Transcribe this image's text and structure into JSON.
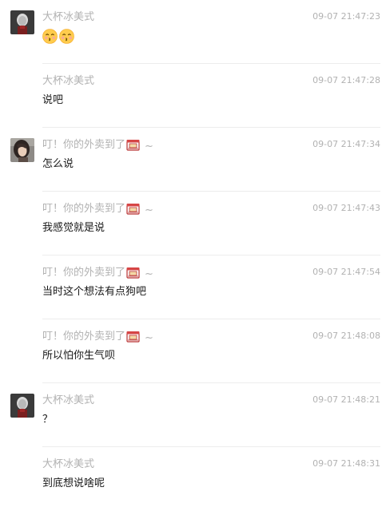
{
  "messages": [
    {
      "sender": "大杯冰美式",
      "time": "09-07 21:47:23",
      "text": "",
      "emojis": [
        "kissing-face-emoji",
        "kissing-face-emoji"
      ],
      "avatar": "avatar-dark",
      "suffix": false
    },
    {
      "sender": "大杯冰美式",
      "time": "09-07 21:47:28",
      "text": "说吧",
      "emojis": [],
      "avatar": "",
      "suffix": false
    },
    {
      "sender": "叮！你的外卖到了",
      "time": "09-07 21:47:34",
      "text": "怎么说",
      "emojis": [],
      "avatar": "avatar-girl",
      "suffix": true
    },
    {
      "sender": "叮！你的外卖到了",
      "time": "09-07 21:47:43",
      "text": "我感觉就是说",
      "emojis": [],
      "avatar": "",
      "suffix": true
    },
    {
      "sender": "叮！你的外卖到了",
      "time": "09-07 21:47:54",
      "text": "当时这个想法有点狗吧",
      "emojis": [],
      "avatar": "",
      "suffix": true
    },
    {
      "sender": "叮！你的外卖到了",
      "time": "09-07 21:48:08",
      "text": "所以怕你生气呗",
      "emojis": [],
      "avatar": "",
      "suffix": true
    },
    {
      "sender": "大杯冰美式",
      "time": "09-07 21:48:21",
      "text": "？",
      "emojis": [],
      "avatar": "avatar-dark",
      "suffix": false
    },
    {
      "sender": "大杯冰美式",
      "time": "09-07 21:48:31",
      "text": "到底想说啥呢",
      "emojis": [],
      "avatar": "",
      "suffix": false
    }
  ],
  "name_suffix": {
    "icon": "takeout-box-icon",
    "tilde": "~"
  },
  "colors": {
    "sender": "#b2b2b2",
    "time": "#b2b2b2",
    "text": "#191919",
    "divider": "#ececec"
  }
}
